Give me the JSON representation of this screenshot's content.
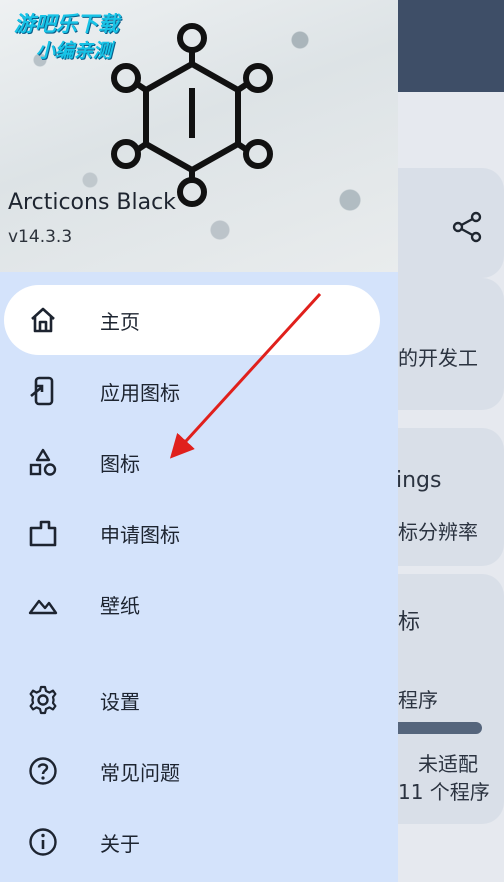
{
  "watermark": {
    "line1": "游吧乐下载",
    "line2": "小编亲测"
  },
  "drawer": {
    "app_name": "Arcticons Black",
    "version": "v14.3.3",
    "items": [
      {
        "label": "主页",
        "icon": "home-icon",
        "active": true
      },
      {
        "label": "应用图标",
        "icon": "apply-icon"
      },
      {
        "label": "图标",
        "icon": "shapes-icon"
      },
      {
        "label": "申请图标",
        "icon": "request-icon"
      },
      {
        "label": "壁纸",
        "icon": "wallpaper-icon"
      },
      {
        "label": "设置",
        "icon": "gear-icon"
      },
      {
        "label": "常见问题",
        "icon": "help-icon"
      },
      {
        "label": "关于",
        "icon": "info-icon"
      }
    ]
  },
  "background": {
    "card1_text": "的开发工",
    "card2_title": "ings",
    "card2_sub": "标分辨率",
    "card3_title": "标",
    "card4_line1": "程序",
    "card4_line2": "未适配",
    "card4_line3": "11 个程序",
    "progress": 0.2
  },
  "colors": {
    "drawer_bg": "#d4e3fb",
    "topbar": "#3e4e67",
    "arrow": "#e0201c"
  }
}
